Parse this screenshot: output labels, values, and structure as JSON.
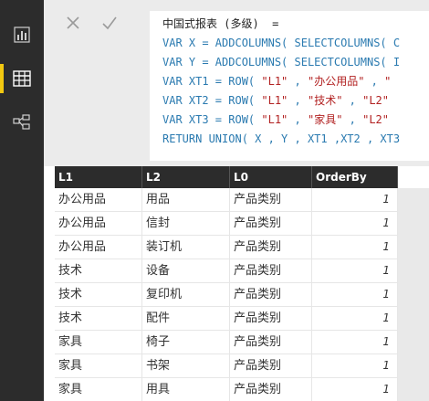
{
  "nav": {
    "items": [
      {
        "name": "report-view-icon",
        "active": false
      },
      {
        "name": "data-view-icon",
        "active": true
      },
      {
        "name": "model-view-icon",
        "active": false
      }
    ]
  },
  "formula": {
    "lines": [
      {
        "parts": [
          {
            "t": "中国式报表 (多级)  ="
          }
        ]
      },
      {
        "parts": [
          {
            "t": "VAR X = ADDCOLUMNS( SELECTCOLUMNS( C"
          }
        ]
      },
      {
        "parts": [
          {
            "t": "VAR Y = ADDCOLUMNS( SELECTCOLUMNS( I"
          }
        ]
      },
      {
        "parts": [
          {
            "t": "VAR XT1 = ROW( "
          },
          {
            "t": "\"L1\"",
            "s": true
          },
          {
            "t": " , "
          },
          {
            "t": "\"办公用品\"",
            "s": true
          },
          {
            "t": " , "
          },
          {
            "t": "\"",
            "s": true
          }
        ]
      },
      {
        "parts": [
          {
            "t": "VAR XT2 = ROW( "
          },
          {
            "t": "\"L1\"",
            "s": true
          },
          {
            "t": " , "
          },
          {
            "t": "\"技术\"",
            "s": true
          },
          {
            "t": " , "
          },
          {
            "t": "\"L2\"",
            "s": true
          }
        ]
      },
      {
        "parts": [
          {
            "t": "VAR XT3 = ROW( "
          },
          {
            "t": "\"L1\"",
            "s": true
          },
          {
            "t": " , "
          },
          {
            "t": "\"家具\"",
            "s": true
          },
          {
            "t": " , "
          },
          {
            "t": "\"L2\"",
            "s": true
          }
        ]
      },
      {
        "parts": [
          {
            "t": "RETURN UNION( X , Y , XT1 ,XT2 , XT3"
          }
        ]
      }
    ]
  },
  "table": {
    "columns": [
      "L1",
      "L2",
      "L0",
      "OrderBy"
    ],
    "rows": [
      [
        "办公用品",
        "用品",
        "产品类别",
        "1"
      ],
      [
        "办公用品",
        "信封",
        "产品类别",
        "1"
      ],
      [
        "办公用品",
        "装订机",
        "产品类别",
        "1"
      ],
      [
        "技术",
        "设备",
        "产品类别",
        "1"
      ],
      [
        "技术",
        "复印机",
        "产品类别",
        "1"
      ],
      [
        "技术",
        "配件",
        "产品类别",
        "1"
      ],
      [
        "家具",
        "椅子",
        "产品类别",
        "1"
      ],
      [
        "家具",
        "书架",
        "产品类别",
        "1"
      ],
      [
        "家具",
        "用具",
        "产品类别",
        "1"
      ]
    ]
  },
  "colors": {
    "rail": "#2c2c2c",
    "accent": "#f2c811",
    "header": "#2c2c2c",
    "keyword": "#2a7ab0",
    "string": "#b22222"
  }
}
